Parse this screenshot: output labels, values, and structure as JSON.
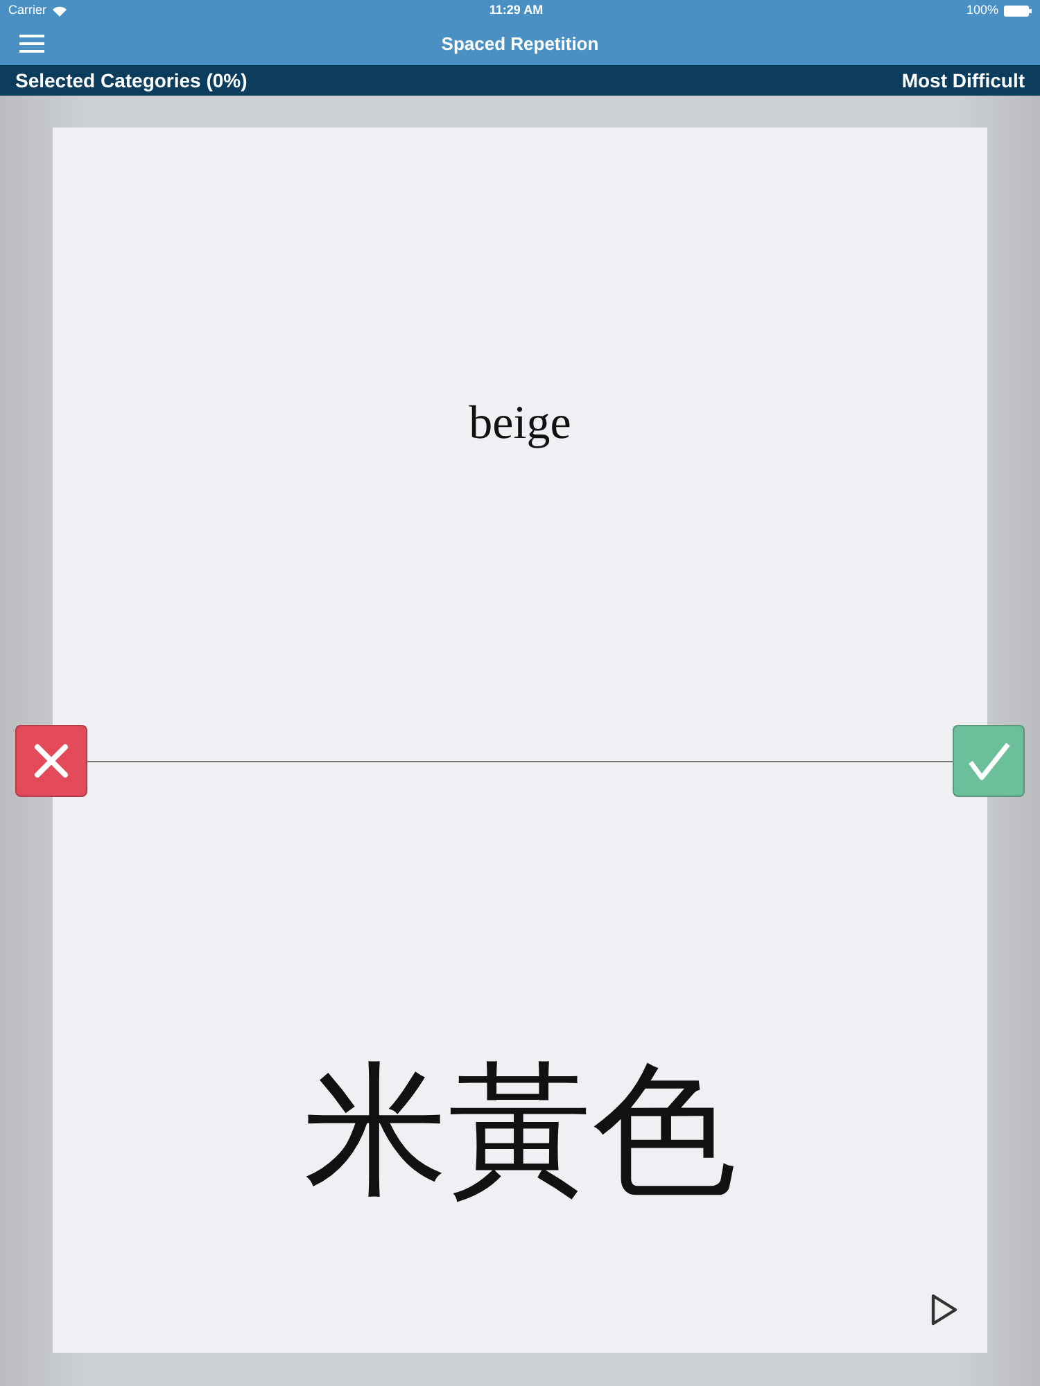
{
  "status_bar": {
    "carrier": "Carrier",
    "time": "11:29 AM",
    "battery": "100%"
  },
  "nav_bar": {
    "title": "Spaced Repetition"
  },
  "category_bar": {
    "left": "Selected Categories (0%)",
    "right": "Most Difficult"
  },
  "card": {
    "prompt": "beige",
    "answer": "米黃色"
  }
}
